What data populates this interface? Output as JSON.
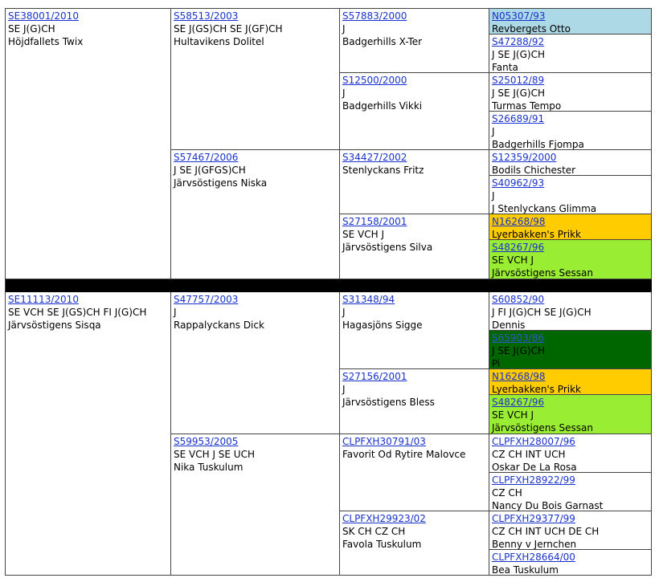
{
  "sire_half": [
    {
      "reg": "SE38001/2010",
      "lines": [
        "SE J(G)CH",
        "Höjdfallets Twix"
      ]
    },
    {
      "reg": "S58513/2003",
      "lines": [
        "SE J(GS)CH SE J(GF)CH",
        "Hultavikens Dolitel"
      ]
    },
    {
      "reg": "S57883/2000",
      "lines": [
        "J",
        "Badgerhills X-Ter"
      ]
    },
    {
      "reg": "N05307/93",
      "lines": [
        "Revbergets Otto"
      ],
      "highlight": "#add8e6"
    },
    {
      "reg": "S47288/92",
      "lines": [
        "J SE J(G)CH",
        "Fanta"
      ]
    },
    {
      "reg": "S12500/2000",
      "lines": [
        "J",
        "Badgerhills Vikki"
      ]
    },
    {
      "reg": "S25012/89",
      "lines": [
        "J SE J(G)CH",
        "Turmas Tempo"
      ]
    },
    {
      "reg": "S26689/91 ",
      "lines": [
        "J",
        "Badgerhills Fjompa"
      ]
    },
    {
      "reg": "S57467/2006",
      "lines": [
        "J SE J(GFGS)CH",
        "Järvsöstigens Niska"
      ]
    },
    {
      "reg": "S34427/2002",
      "lines": [
        "Stenlyckans Fritz"
      ]
    },
    {
      "reg": "S12359/2000",
      "lines": [
        "Bodils Chichester"
      ]
    },
    {
      "reg": "S40962/93",
      "lines": [
        "J",
        "J Stenlyckans Glimma"
      ]
    },
    {
      "reg": "S27158/2001",
      "lines": [
        "SE VCH J",
        "Järvsöstigens Silva"
      ]
    },
    {
      "reg": "N16268/98",
      "lines": [
        "Lyerbakken's Prikk"
      ],
      "highlight": "#ffcc00"
    },
    {
      "reg": "S48267/96",
      "lines": [
        "SE VCH J",
        "Järvsöstigens Sessan"
      ],
      "highlight": "#99ee33"
    }
  ],
  "dam_half": [
    {
      "reg": "SE11113/2010",
      "lines": [
        "SE VCH SE J(GS)CH FI J(G)CH",
        "Järvsöstigens Sisqa"
      ]
    },
    {
      "reg": "S47757/2003",
      "lines": [
        "J",
        "Rappalyckans Dick"
      ]
    },
    {
      "reg": "S31348/94",
      "lines": [
        "J",
        "Hagasjöns Sigge"
      ]
    },
    {
      "reg": "S60852/90",
      "lines": [
        "J FI J(G)CH SE J(G)CH",
        "Dennis"
      ]
    },
    {
      "reg": "S65903/86",
      "lines": [
        "J SE J(G)CH",
        "Pi"
      ],
      "highlight": "#006600"
    },
    {
      "reg": "S27156/2001",
      "lines": [
        "J",
        "Järvsöstigens Bless"
      ]
    },
    {
      "reg": "N16268/98",
      "lines": [
        "Lyerbakken's Prikk"
      ],
      "highlight": "#ffcc00"
    },
    {
      "reg": "S48267/96",
      "lines": [
        "SE VCH J",
        "Järvsöstigens Sessan"
      ],
      "highlight": "#99ee33"
    },
    {
      "reg": "S59953/2005",
      "lines": [
        "SE VCH J SE UCH",
        "Nika Tuskulum"
      ]
    },
    {
      "reg": "CLPFXH30791/03",
      "lines": [
        "Favorit Od Rytire Malovce"
      ]
    },
    {
      "reg": "CLPFXH28007/96",
      "lines": [
        "CZ CH INT UCH",
        "Oskar De La Rosa"
      ]
    },
    {
      "reg": "CLPFXH28922/99",
      "lines": [
        "CZ CH",
        "Nancy Du Bois Garnast"
      ]
    },
    {
      "reg": "CLPFXH29923/02",
      "lines": [
        "SK CH CZ CH",
        "Favola Tuskulum"
      ]
    },
    {
      "reg": "CLPFXH29377/99",
      "lines": [
        "CZ CH INT UCH DE CH",
        "Benny v Jernchen"
      ]
    },
    {
      "reg": "CLPFXH28664/00",
      "lines": [
        "Bea Tuskulum"
      ]
    }
  ]
}
